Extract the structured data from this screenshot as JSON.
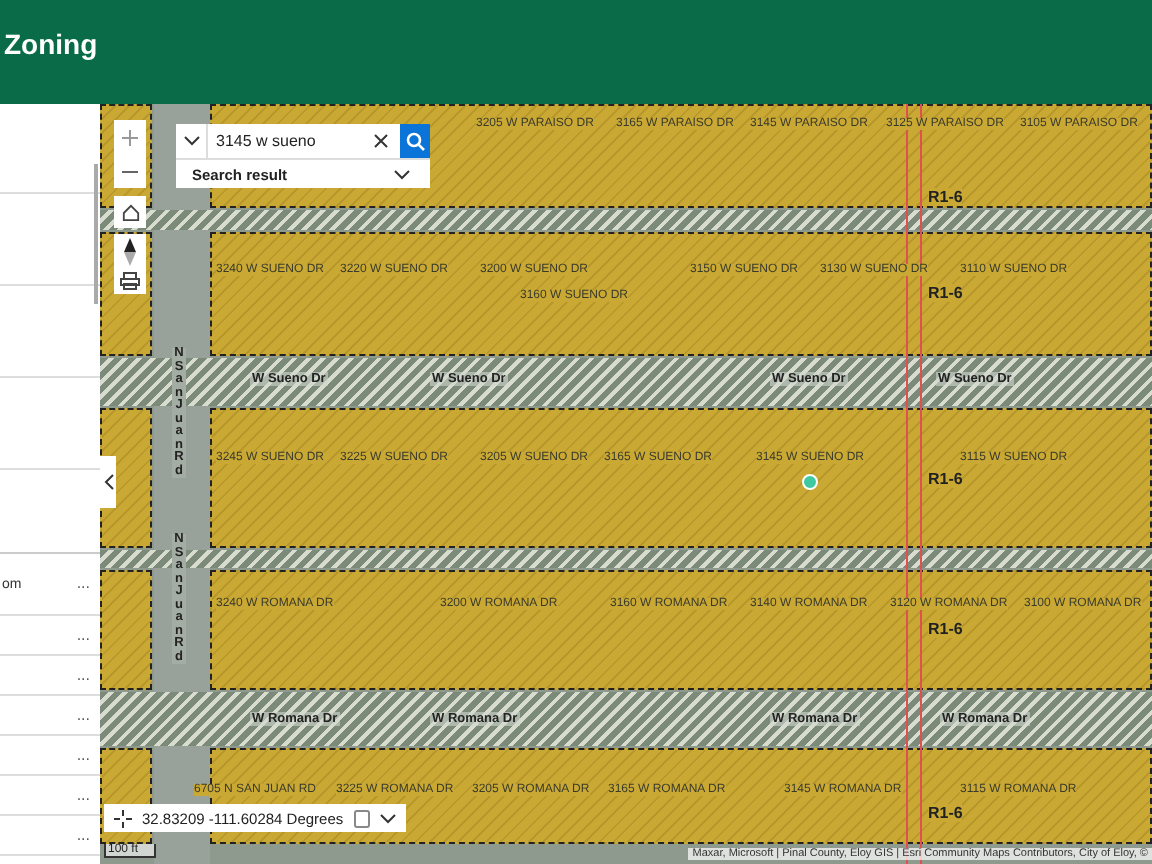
{
  "header": {
    "title": "Zoning"
  },
  "side_panel": {
    "rows": [
      {
        "text": "om",
        "menu": "..."
      },
      {
        "text": "",
        "menu": "..."
      },
      {
        "text": "",
        "menu": "..."
      },
      {
        "text": "",
        "menu": "..."
      },
      {
        "text": "",
        "menu": "..."
      },
      {
        "text": "",
        "menu": "..."
      },
      {
        "text": "",
        "menu": "..."
      }
    ]
  },
  "search": {
    "value": "3145 w sueno",
    "result_label": "Search result"
  },
  "map": {
    "address_labels": [
      "3205 W PARAISO DR",
      "3165 W PARAISO DR",
      "3145 W PARAISO DR",
      "3125 W PARAISO DR",
      "3105 W PARAISO DR",
      "3240 W SUENO DR",
      "3220 W SUENO DR",
      "3200 W SUENO DR",
      "3160 W SUENO DR",
      "3150 W SUENO DR",
      "3130 W SUENO DR",
      "3110 W SUENO DR",
      "3245 W SUENO DR",
      "3225 W SUENO DR",
      "3205 W SUENO DR",
      "3165 W SUENO DR",
      "3145 W SUENO DR",
      "3115 W SUENO DR",
      "3240 W ROMANA DR",
      "3200 W ROMANA DR",
      "3160 W ROMANA DR",
      "3140 W ROMANA DR",
      "3120 W ROMANA DR",
      "3100 W ROMANA DR",
      "6705 N SAN JUAN RD",
      "3225 W ROMANA DR",
      "3205 W ROMANA DR",
      "3165 W ROMANA DR",
      "3145 W ROMANA DR",
      "3115 W ROMANA DR"
    ],
    "zoning_labels": [
      "R1-6",
      "R1-6",
      "R1-6",
      "R1-6",
      "R1-6"
    ],
    "street_labels": [
      "W Sueno Dr",
      "W Sueno Dr",
      "W Sueno Dr",
      "W Sueno Dr",
      "W Romana Dr",
      "W Romana Dr",
      "W Romana Dr",
      "W Romana Dr"
    ],
    "vertical_street_labels": [
      "N San Juan Rd",
      "N San Juan Rd"
    ],
    "coordinates": "32.83209 -111.60284 Degrees",
    "scale": "100 ft",
    "attribution": "Maxar, Microsoft | Pinal County, Eloy GIS | Esri Community Maps Contributors, City of Eloy, ©"
  }
}
